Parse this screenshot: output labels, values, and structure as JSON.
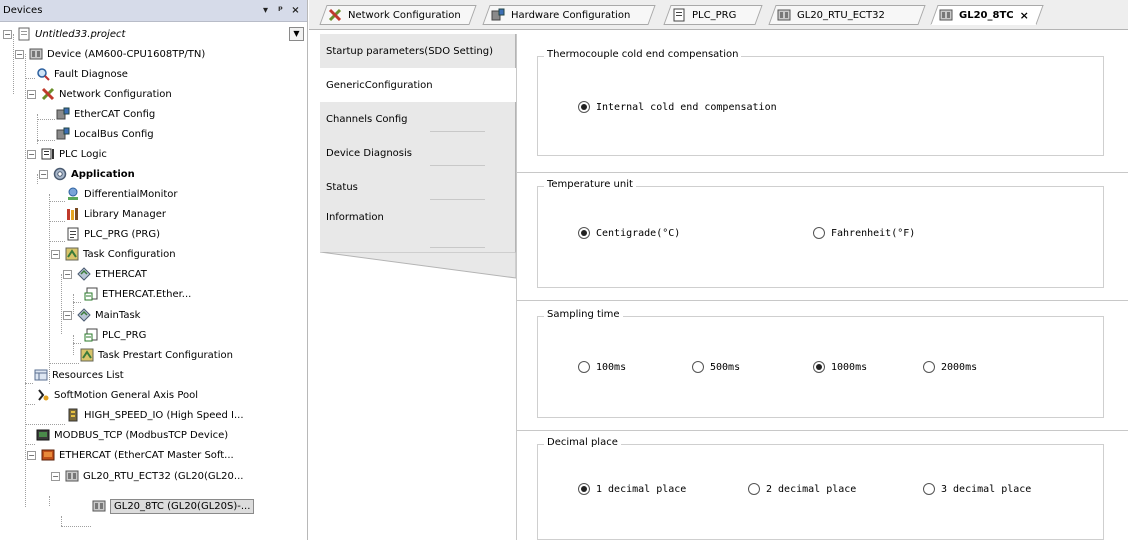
{
  "devices_panel": {
    "title": "Devices",
    "controls": {
      "dropdown": "▾",
      "pin": "ᵖ",
      "close": "×"
    },
    "tree": [
      {
        "label": "Untitled33.project",
        "icon": "project-icon"
      },
      {
        "label": "Device (AM600-CPU1608TP/TN)",
        "icon": "device-icon"
      },
      {
        "label": "Fault Diagnose",
        "icon": "magnifier-icon"
      },
      {
        "label": "Network Configuration",
        "icon": "network-config-icon"
      },
      {
        "label": "EtherCAT Config",
        "icon": "ethercat-config-icon"
      },
      {
        "label": "LocalBus Config",
        "icon": "localbus-config-icon"
      },
      {
        "label": "PLC Logic",
        "icon": "plc-logic-icon"
      },
      {
        "label": "Application",
        "icon": "application-gear-icon"
      },
      {
        "label": "DifferentialMonitor",
        "icon": "monitor-icon"
      },
      {
        "label": "Library Manager",
        "icon": "library-icon"
      },
      {
        "label": "PLC_PRG (PRG)",
        "icon": "program-icon"
      },
      {
        "label": "Task Configuration",
        "icon": "task-config-icon"
      },
      {
        "label": "ETHERCAT",
        "icon": "task-icon"
      },
      {
        "label": "ETHERCAT.Ether...",
        "icon": "task-call-icon"
      },
      {
        "label": "MainTask",
        "icon": "task-icon"
      },
      {
        "label": "PLC_PRG",
        "icon": "task-call-icon"
      },
      {
        "label": "Task Prestart Configuration",
        "icon": "task-config-icon"
      },
      {
        "label": "Resources List",
        "icon": "resources-icon"
      },
      {
        "label": "SoftMotion General Axis Pool",
        "icon": "axis-pool-icon"
      },
      {
        "label": "HIGH_SPEED_IO (High Speed I...",
        "icon": "io-module-icon"
      },
      {
        "label": "MODBUS_TCP (ModbusTCP Device)",
        "icon": "modbus-device-icon"
      },
      {
        "label": "ETHERCAT (EtherCAT Master Soft...",
        "icon": "ethercat-master-icon"
      },
      {
        "label": "GL20_RTU_ECT32 (GL20(GL20...",
        "icon": "module-icon"
      },
      {
        "label": "GL20_8TC (GL20(GL20S)-...",
        "icon": "module-icon"
      }
    ]
  },
  "tabs": [
    {
      "label": "Network Configuration",
      "icon": "network-config-icon"
    },
    {
      "label": "Hardware Configuration",
      "icon": "hardware-config-icon"
    },
    {
      "label": "PLC_PRG",
      "icon": "program-icon"
    },
    {
      "label": "GL20_RTU_ECT32",
      "icon": "module-icon"
    },
    {
      "label": "GL20_8TC",
      "icon": "module-icon",
      "close": "×"
    }
  ],
  "side_tabs": [
    "Startup parameters(SDO Setting)",
    "GenericConfiguration",
    "Channels Config",
    "Device Diagnosis",
    "Status",
    "Information"
  ],
  "groups": {
    "cold_end": {
      "title": "Thermocouple cold end compensation",
      "options": [
        {
          "label": "Internal cold end compensation",
          "checked": true
        }
      ]
    },
    "temperature_unit": {
      "title": "Temperature unit",
      "options": [
        {
          "label": "Centigrade(°C)",
          "checked": true
        },
        {
          "label": "Fahrenheit(°F)",
          "checked": false
        }
      ]
    },
    "sampling_time": {
      "title": "Sampling time",
      "options": [
        {
          "label": "100ms",
          "checked": false
        },
        {
          "label": "500ms",
          "checked": false
        },
        {
          "label": "1000ms",
          "checked": true
        },
        {
          "label": "2000ms",
          "checked": false
        }
      ]
    },
    "decimal_place": {
      "title": "Decimal place",
      "options": [
        {
          "label": "1 decimal place",
          "checked": true
        },
        {
          "label": "2 decimal place",
          "checked": false
        },
        {
          "label": "3 decimal place",
          "checked": false
        }
      ]
    }
  },
  "colors": {
    "header_bg": "#d6dbe9",
    "tab_bar_bg": "#eeeeee",
    "side_tab_bg": "#e8e8e8",
    "selected_bg": "#dcdcdc"
  }
}
